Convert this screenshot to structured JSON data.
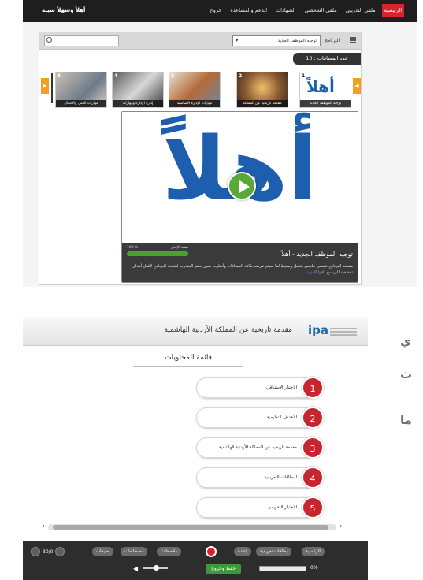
{
  "top": {
    "navbar": {
      "brand": "أهلاً وسهلاً شيبة",
      "items": [
        {
          "label": "الرئيسية",
          "active": true
        },
        {
          "label": "ملفي التدريبي",
          "active": false
        },
        {
          "label": "ملفي الشخصي",
          "active": false
        },
        {
          "label": "الشهادات",
          "active": false
        },
        {
          "label": "الدعم والمساعدة",
          "active": false
        },
        {
          "label": "خروج",
          "active": false
        }
      ]
    },
    "toolbar": {
      "program_label": "البرنامج",
      "program_value": "توجيه الموظف الجديد",
      "search_placeholder": ""
    },
    "count_badge": "عدد المساقات : 13",
    "carousel": {
      "prev_arrow": "▶",
      "next_arrow": "◀",
      "thumbs": [
        {
          "num": "5",
          "caption": "مهارات العمل والاتصال"
        },
        {
          "num": "4",
          "caption": "إدارة الإدارة ومهاراته"
        },
        {
          "num": "3",
          "caption": "مهارات الإدارة الأساسية"
        },
        {
          "num": "2",
          "caption": "مقدمة تاريخية عن المملكة"
        },
        {
          "num": "1",
          "caption": "توجيه الموظف الجديد",
          "logo": "أهلاً"
        }
      ]
    },
    "player": {
      "logo_text": "أهلاً",
      "title": "توجيه الموظف الجديد - أهلاً",
      "progress_label": "نسبة الإنجاز",
      "progress_pct_text": "100 %",
      "progress_value": 100,
      "description": "مقدمة البرنامج تتضمن ملخص شامل وبسيط لما سيتم عرضه بكافة المساقات وأسلوب شيق يحفز المتدرب لمتابعة البرنامج لأكمل أهداف تحقيقية للبرنامج.",
      "more_link": "اقرأ المزيد"
    }
  },
  "bottom": {
    "header": {
      "logo": "ipa",
      "course_title": "مقدمة تاريخية عن المملكة الأردنية الهاشمية"
    },
    "toc": {
      "title": "قائمة المحتويات",
      "items": [
        {
          "num": "1",
          "label": "الاختبار الاستباقي"
        },
        {
          "num": "2",
          "label": "الأهداف التعليمية"
        },
        {
          "num": "3",
          "label": "مقدمة تاريخية عن المملكة الأردنية الهاشمية"
        },
        {
          "num": "4",
          "label": "البطاقات التعريفية"
        },
        {
          "num": "5",
          "label": "الاختبار التقويمي"
        }
      ]
    },
    "controls": {
      "buttons": [
        "الرئيسية",
        "بطاقات تعريفية",
        "إعادة",
        "ملاحظات",
        "مصطلحات",
        "تعليقات"
      ],
      "page_counter": "30/0",
      "save_exit": "حفظ وخروج",
      "course_pct": "0%"
    }
  },
  "side_text": [
    "ي",
    "ث",
    "ما"
  ],
  "colors": {
    "brand_blue": "#1d5fae",
    "nav_active": "#d9232a",
    "toc_number": "#c7252f",
    "progress_green": "#45a32e"
  }
}
